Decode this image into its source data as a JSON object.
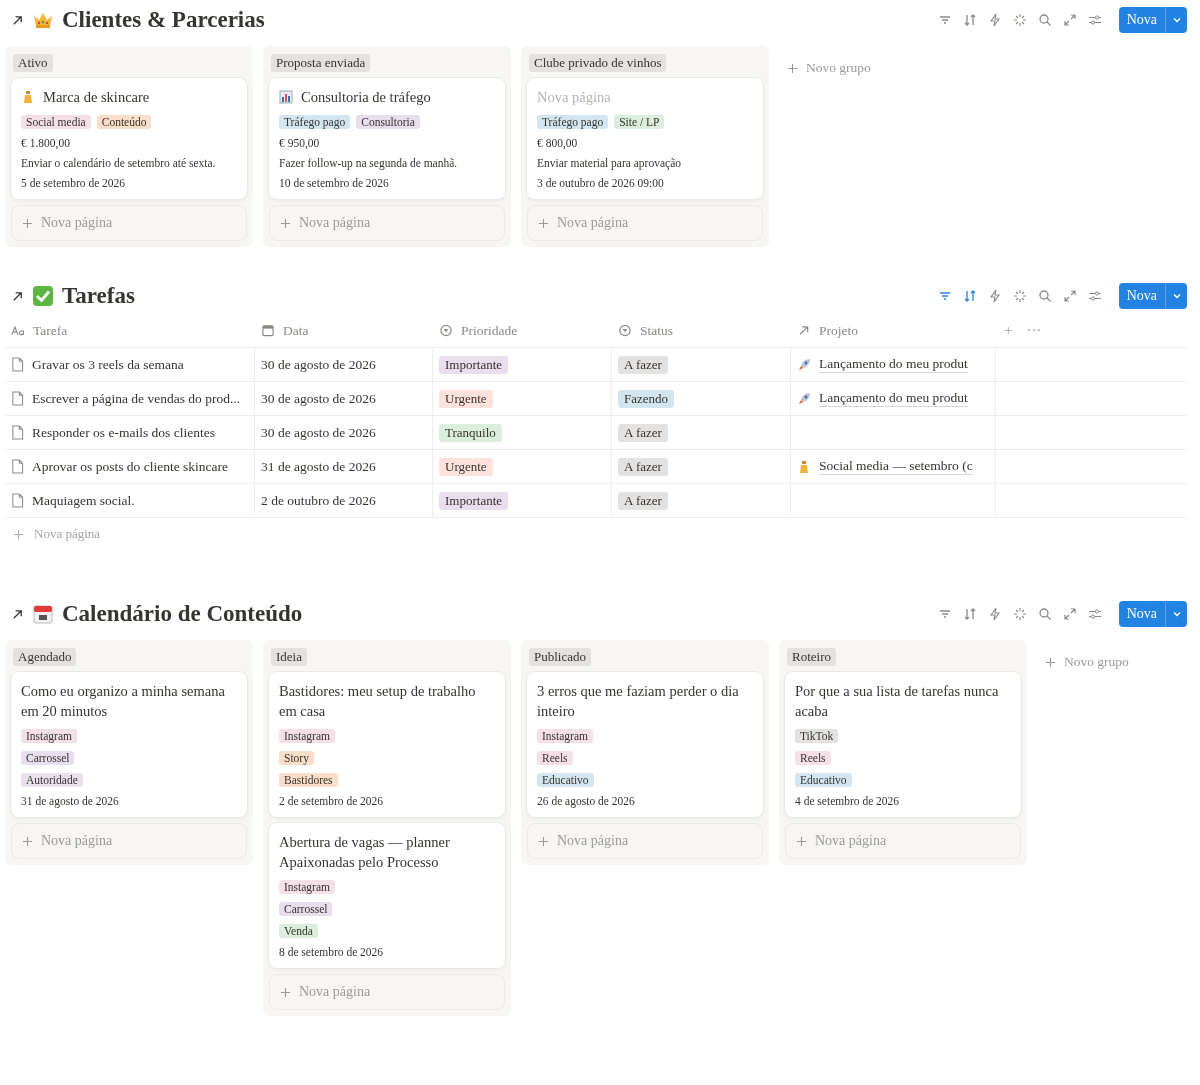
{
  "sections": [
    {
      "kind": "board",
      "title": "Clientes & Parcerias",
      "filter_active": false,
      "sort_active": false,
      "new_button": "Nova",
      "new_group": "Novo grupo",
      "groups": [
        {
          "label": "Ativo",
          "add_label": "Nova página",
          "cards": [
            {
              "title": "Marca de skincare",
              "untitled": false,
              "tags": [
                {
                  "label": "Social media",
                  "color": "#f5e0e9"
                },
                {
                  "label": "Conteúdo",
                  "color": "#fadec9"
                }
              ],
              "lines": [
                "€ 1.800,00",
                "Enviar o calendário de setembro até sexta.",
                "5 de setembro de 2026"
              ]
            }
          ]
        },
        {
          "label": "Proposta enviada",
          "add_label": "Nova página",
          "cards": [
            {
              "title": "Consultoria de tráfego",
              "untitled": false,
              "tags": [
                {
                  "label": "Tráfego pago",
                  "color": "#d3e5ef"
                },
                {
                  "label": "Consultoria",
                  "color": "#e8deee"
                }
              ],
              "lines": [
                "€ 950,00",
                "Fazer follow-up na segunda de manhã.",
                "10 de setembro de 2026"
              ]
            }
          ]
        },
        {
          "label": "Clube privado de vinhos",
          "add_label": "Nova página",
          "cards": [
            {
              "title": "Nova página",
              "untitled": true,
              "tags": [
                {
                  "label": "Tráfego pago",
                  "color": "#d3e5ef"
                },
                {
                  "label": "Site / LP",
                  "color": "#dbeddb"
                }
              ],
              "lines": [
                "€ 800,00",
                "Enviar material para aprovação",
                "3 de outubro de 2026 09:00"
              ]
            }
          ]
        }
      ]
    },
    {
      "kind": "table",
      "title": "Tarefas",
      "filter_active": true,
      "sort_active": true,
      "new_button": "Nova",
      "columns": [
        {
          "label": "Tarefa"
        },
        {
          "label": "Data"
        },
        {
          "label": "Prioridade"
        },
        {
          "label": "Status"
        },
        {
          "label": "Projeto"
        }
      ],
      "add_column": "+",
      "more": "···",
      "rows": [
        {
          "title": "Gravar os 3 reels da semana",
          "date": "30 de agosto de 2026",
          "priority": {
            "label": "Importante",
            "color": "#e8deee"
          },
          "status": {
            "label": "A fazer",
            "color": "#e3e2e0"
          },
          "project": {
            "label": "Lançamento do meu produt"
          }
        },
        {
          "title": "Escrever a página de vendas do prod...",
          "date": "30 de agosto de 2026",
          "priority": {
            "label": "Urgente",
            "color": "#ffe2dd"
          },
          "status": {
            "label": "Fazendo",
            "color": "#d3e5ef"
          },
          "project": {
            "label": "Lançamento do meu produt"
          }
        },
        {
          "title": "Responder os e-mails dos clientes",
          "date": "30 de agosto de 2026",
          "priority": {
            "label": "Tranquilo",
            "color": "#dbeddb"
          },
          "status": {
            "label": "A fazer",
            "color": "#e3e2e0"
          }
        },
        {
          "title": "Aprovar os posts do cliente skincare",
          "date": "31 de agosto de 2026",
          "priority": {
            "label": "Urgente",
            "color": "#ffe2dd"
          },
          "status": {
            "label": "A fazer",
            "color": "#e3e2e0"
          },
          "project": {
            "label": "Social media — setembro (c"
          }
        },
        {
          "title": "Maquiagem social.",
          "date": "2 de outubro de 2026",
          "priority": {
            "label": "Importante",
            "color": "#e8deee"
          },
          "status": {
            "label": "A fazer",
            "color": "#e3e2e0"
          }
        }
      ],
      "add_label": "Nova página"
    },
    {
      "kind": "board",
      "title": "Calendário de Conteúdo",
      "filter_active": false,
      "sort_active": false,
      "new_button": "Nova",
      "new_group": "Novo grupo",
      "groups": [
        {
          "label": "Agendado",
          "add_label": "Nova página",
          "cards": [
            {
              "title": "Como eu organizo a minha semana em 20 minutos",
              "untitled": false,
              "tags": [
                {
                  "label": "Instagram",
                  "color": "#f5e0e9"
                },
                {
                  "label": "Carrossel",
                  "color": "#e8deee"
                },
                {
                  "label": "Autoridade",
                  "color": "#e8deee"
                }
              ],
              "lines": [
                "31 de agosto de 2026"
              ]
            }
          ]
        },
        {
          "label": "Ideia",
          "add_label": "Nova página",
          "cards": [
            {
              "title": "Bastidores: meu setup de trabalho em casa",
              "untitled": false,
              "tags": [
                {
                  "label": "Instagram",
                  "color": "#f5e0e9"
                },
                {
                  "label": "Story",
                  "color": "#fadec9"
                },
                {
                  "label": "Bastidores",
                  "color": "#fadec9"
                }
              ],
              "lines": [
                "2 de setembro de 2026"
              ]
            },
            {
              "title": "Abertura de vagas — planner Apaixonadas pelo Processo",
              "untitled": false,
              "tags": [
                {
                  "label": "Instagram",
                  "color": "#f5e0e9"
                },
                {
                  "label": "Carrossel",
                  "color": "#e8deee"
                },
                {
                  "label": "Venda",
                  "color": "#dbeddb"
                }
              ],
              "lines": [
                "8 de setembro de 2026"
              ]
            }
          ]
        },
        {
          "label": "Publicado",
          "add_label": "Nova página",
          "cards": [
            {
              "title": "3 erros que me faziam perder o dia inteiro",
              "untitled": false,
              "tags": [
                {
                  "label": "Instagram",
                  "color": "#f5e0e9"
                },
                {
                  "label": "Reels",
                  "color": "#f5e0e9"
                },
                {
                  "label": "Educativo",
                  "color": "#d3e5ef"
                }
              ],
              "lines": [
                "26 de agosto de 2026"
              ]
            }
          ]
        },
        {
          "label": "Roteiro",
          "add_label": "Nova página",
          "cards": [
            {
              "title": "Por que a sua lista de tarefas nunca acaba",
              "untitled": false,
              "tags": [
                {
                  "label": "TikTok",
                  "color": "#e3e2e0"
                },
                {
                  "label": "Reels",
                  "color": "#f5e0e9"
                },
                {
                  "label": "Educativo",
                  "color": "#d3e5ef"
                }
              ],
              "lines": [
                "4 de setembro de 2026"
              ]
            }
          ]
        }
      ]
    }
  ]
}
